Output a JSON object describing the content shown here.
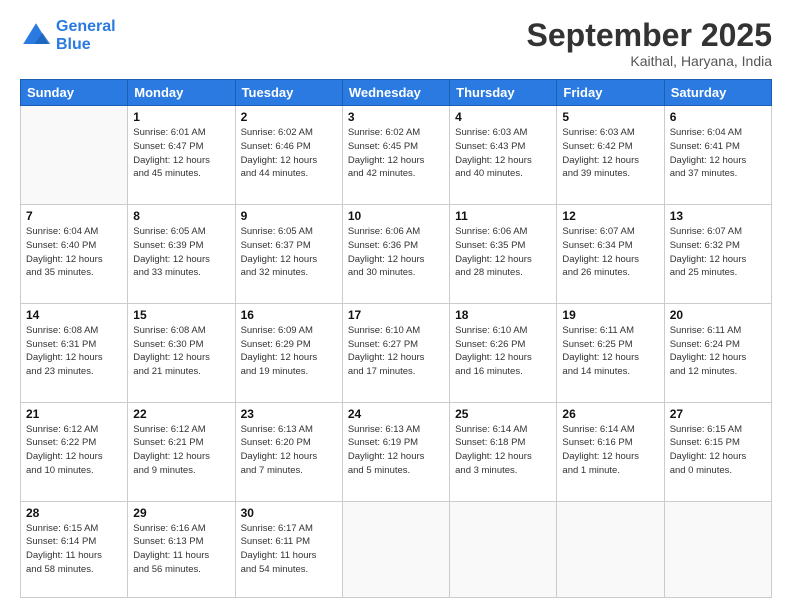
{
  "header": {
    "logo_line1": "General",
    "logo_line2": "Blue",
    "month": "September 2025",
    "location": "Kaithal, Haryana, India"
  },
  "days_of_week": [
    "Sunday",
    "Monday",
    "Tuesday",
    "Wednesday",
    "Thursday",
    "Friday",
    "Saturday"
  ],
  "weeks": [
    [
      {
        "day": "",
        "info": ""
      },
      {
        "day": "1",
        "info": "Sunrise: 6:01 AM\nSunset: 6:47 PM\nDaylight: 12 hours\nand 45 minutes."
      },
      {
        "day": "2",
        "info": "Sunrise: 6:02 AM\nSunset: 6:46 PM\nDaylight: 12 hours\nand 44 minutes."
      },
      {
        "day": "3",
        "info": "Sunrise: 6:02 AM\nSunset: 6:45 PM\nDaylight: 12 hours\nand 42 minutes."
      },
      {
        "day": "4",
        "info": "Sunrise: 6:03 AM\nSunset: 6:43 PM\nDaylight: 12 hours\nand 40 minutes."
      },
      {
        "day": "5",
        "info": "Sunrise: 6:03 AM\nSunset: 6:42 PM\nDaylight: 12 hours\nand 39 minutes."
      },
      {
        "day": "6",
        "info": "Sunrise: 6:04 AM\nSunset: 6:41 PM\nDaylight: 12 hours\nand 37 minutes."
      }
    ],
    [
      {
        "day": "7",
        "info": "Sunrise: 6:04 AM\nSunset: 6:40 PM\nDaylight: 12 hours\nand 35 minutes."
      },
      {
        "day": "8",
        "info": "Sunrise: 6:05 AM\nSunset: 6:39 PM\nDaylight: 12 hours\nand 33 minutes."
      },
      {
        "day": "9",
        "info": "Sunrise: 6:05 AM\nSunset: 6:37 PM\nDaylight: 12 hours\nand 32 minutes."
      },
      {
        "day": "10",
        "info": "Sunrise: 6:06 AM\nSunset: 6:36 PM\nDaylight: 12 hours\nand 30 minutes."
      },
      {
        "day": "11",
        "info": "Sunrise: 6:06 AM\nSunset: 6:35 PM\nDaylight: 12 hours\nand 28 minutes."
      },
      {
        "day": "12",
        "info": "Sunrise: 6:07 AM\nSunset: 6:34 PM\nDaylight: 12 hours\nand 26 minutes."
      },
      {
        "day": "13",
        "info": "Sunrise: 6:07 AM\nSunset: 6:32 PM\nDaylight: 12 hours\nand 25 minutes."
      }
    ],
    [
      {
        "day": "14",
        "info": "Sunrise: 6:08 AM\nSunset: 6:31 PM\nDaylight: 12 hours\nand 23 minutes."
      },
      {
        "day": "15",
        "info": "Sunrise: 6:08 AM\nSunset: 6:30 PM\nDaylight: 12 hours\nand 21 minutes."
      },
      {
        "day": "16",
        "info": "Sunrise: 6:09 AM\nSunset: 6:29 PM\nDaylight: 12 hours\nand 19 minutes."
      },
      {
        "day": "17",
        "info": "Sunrise: 6:10 AM\nSunset: 6:27 PM\nDaylight: 12 hours\nand 17 minutes."
      },
      {
        "day": "18",
        "info": "Sunrise: 6:10 AM\nSunset: 6:26 PM\nDaylight: 12 hours\nand 16 minutes."
      },
      {
        "day": "19",
        "info": "Sunrise: 6:11 AM\nSunset: 6:25 PM\nDaylight: 12 hours\nand 14 minutes."
      },
      {
        "day": "20",
        "info": "Sunrise: 6:11 AM\nSunset: 6:24 PM\nDaylight: 12 hours\nand 12 minutes."
      }
    ],
    [
      {
        "day": "21",
        "info": "Sunrise: 6:12 AM\nSunset: 6:22 PM\nDaylight: 12 hours\nand 10 minutes."
      },
      {
        "day": "22",
        "info": "Sunrise: 6:12 AM\nSunset: 6:21 PM\nDaylight: 12 hours\nand 9 minutes."
      },
      {
        "day": "23",
        "info": "Sunrise: 6:13 AM\nSunset: 6:20 PM\nDaylight: 12 hours\nand 7 minutes."
      },
      {
        "day": "24",
        "info": "Sunrise: 6:13 AM\nSunset: 6:19 PM\nDaylight: 12 hours\nand 5 minutes."
      },
      {
        "day": "25",
        "info": "Sunrise: 6:14 AM\nSunset: 6:18 PM\nDaylight: 12 hours\nand 3 minutes."
      },
      {
        "day": "26",
        "info": "Sunrise: 6:14 AM\nSunset: 6:16 PM\nDaylight: 12 hours\nand 1 minute."
      },
      {
        "day": "27",
        "info": "Sunrise: 6:15 AM\nSunset: 6:15 PM\nDaylight: 12 hours\nand 0 minutes."
      }
    ],
    [
      {
        "day": "28",
        "info": "Sunrise: 6:15 AM\nSunset: 6:14 PM\nDaylight: 11 hours\nand 58 minutes."
      },
      {
        "day": "29",
        "info": "Sunrise: 6:16 AM\nSunset: 6:13 PM\nDaylight: 11 hours\nand 56 minutes."
      },
      {
        "day": "30",
        "info": "Sunrise: 6:17 AM\nSunset: 6:11 PM\nDaylight: 11 hours\nand 54 minutes."
      },
      {
        "day": "",
        "info": ""
      },
      {
        "day": "",
        "info": ""
      },
      {
        "day": "",
        "info": ""
      },
      {
        "day": "",
        "info": ""
      }
    ]
  ]
}
